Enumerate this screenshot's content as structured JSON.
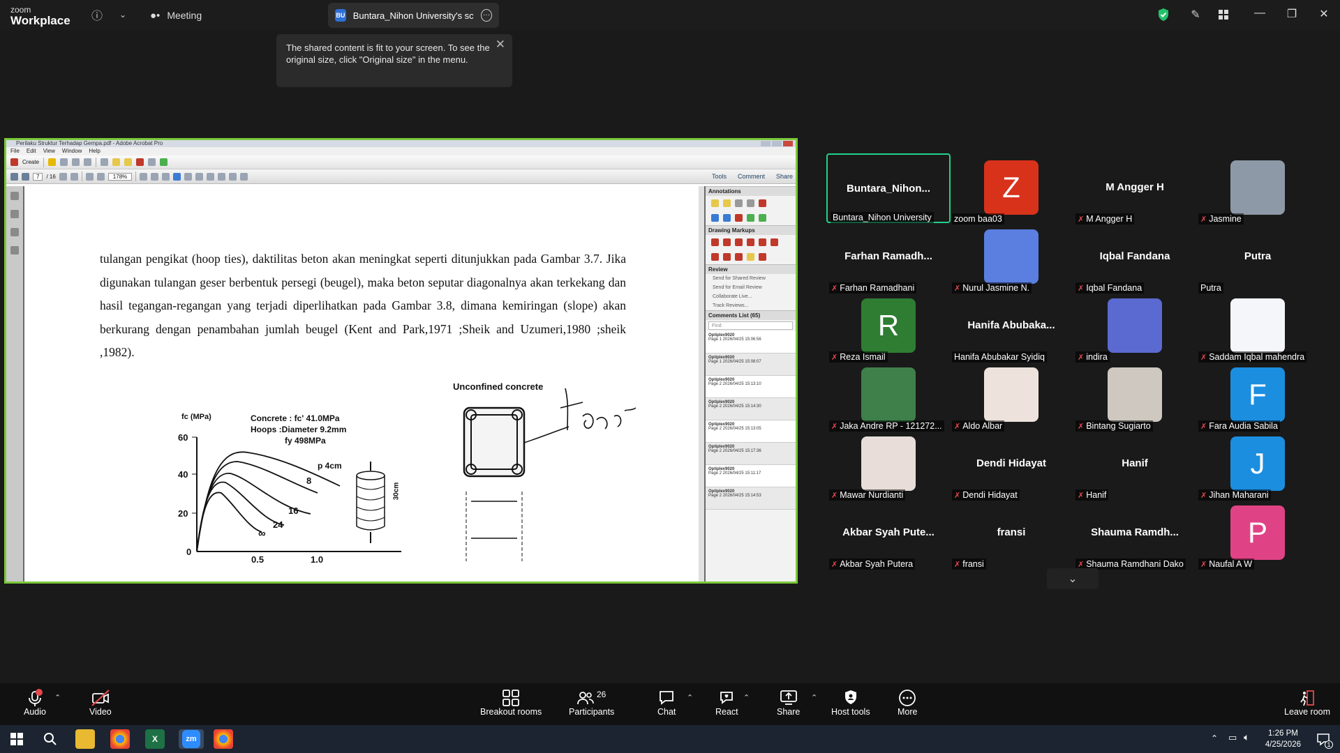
{
  "titlebar": {
    "logo_small": "zoom",
    "logo_big": "Workplace",
    "meeting_label": "Meeting",
    "share_initials": "BU",
    "share_tab_label": "Buntara_Nihon University's screen"
  },
  "toast": {
    "message": "The shared content is fit to your screen. To see the original size, click \"Original size\" in the menu."
  },
  "acrobat": {
    "window_title": "Perilaku Struktur Terhadap Gempa.pdf - Adobe Acrobat Pro",
    "menu": [
      "File",
      "Edit",
      "View",
      "Window",
      "Help"
    ],
    "create_label": "Create",
    "page_current": "7",
    "page_total": "/ 16",
    "zoom": "178%",
    "right_tabs": [
      "Tools",
      "Comment",
      "Share"
    ],
    "panel": {
      "annotations": "Annotations",
      "drawing_markups": "Drawing Markups",
      "review": "Review",
      "review_items": [
        "Send for Shared Review",
        "Send for Email Review",
        "Collaborate Live...",
        "Track Reviews..."
      ],
      "comments_list": "Comments List (65)",
      "find_placeholder": "Find",
      "comments": [
        {
          "author": "Optiplex9020",
          "meta": "Page 1  2026/04/25 15:06:56"
        },
        {
          "author": "Optiplex9020",
          "meta": "Page 1  2026/04/25 15:08:07"
        },
        {
          "author": "Optiplex9020",
          "meta": "Page 2  2026/04/25 15:13:10"
        },
        {
          "author": "Optiplex9020",
          "meta": "Page 2  2026/04/25 15:14:30"
        },
        {
          "author": "Optiplex9020",
          "meta": "Page 2  2026/04/25 15:13:05"
        },
        {
          "author": "Optiplex9020",
          "meta": "Page 2  2026/04/25 15:17:36"
        },
        {
          "author": "Optiplex9020",
          "meta": "Page 2  2026/04/25 15:11:17"
        },
        {
          "author": "Optiplex9020",
          "meta": "Page 2  2026/04/25 15:14:53"
        }
      ]
    },
    "document": {
      "paragraph": "tulangan pengikat (hoop ties), daktilitas beton akan meningkat seperti ditunjukkan pada Gambar 3.7.  Jika digunakan tulangan geser berbentuk persegi (beugel), maka beton seputar diagonalnya akan terkekang dan hasil tegangan-regangan yang terjadi diperlihatkan pada Gambar 3.8, dimana kemiringan (slope) akan berkurang dengan penambahan jumlah beugel (Kent and Park,1971 ;Sheik and Uzumeri,1980 ;sheik ,1982).",
      "figure": {
        "ylabel": "fc (MPa)",
        "concrete": "Concrete : fc' 41.0MPa",
        "hoops": "Hoops :Diameter 9.2mm",
        "fy": "fy 498MPa",
        "y_ticks": [
          "60",
          "40",
          "20",
          "0"
        ],
        "x_ticks": [
          "0.5",
          "1.0"
        ],
        "curve_labels": [
          "p 4cm",
          "8",
          "16",
          "24",
          "∞"
        ],
        "cylinder_label": "30cm",
        "unconfined": "Unconfined  concrete",
        "handwriting": "geser"
      }
    }
  },
  "participants": [
    {
      "display": "Buntara_Nihon...",
      "label": "Buntara_Nihon University",
      "muted": false,
      "type": "name",
      "active": true
    },
    {
      "display": "Z",
      "label": "zoom baa03",
      "muted": false,
      "type": "letter",
      "color": "#d8321b"
    },
    {
      "display": "M Angger H",
      "label": "M Angger H",
      "muted": true,
      "type": "name"
    },
    {
      "display": "",
      "label": "Jasmine",
      "muted": true,
      "type": "photo",
      "color": "#8e99a8"
    },
    {
      "display": "Farhan  Ramadh...",
      "label": "Farhan Ramadhani",
      "muted": true,
      "type": "name"
    },
    {
      "display": "",
      "label": "Nurul Jasmine N.",
      "muted": true,
      "type": "photo",
      "color": "#5b7fe0"
    },
    {
      "display": "Iqbal Fandana",
      "label": "Iqbal Fandana",
      "muted": true,
      "type": "name"
    },
    {
      "display": "Putra",
      "label": "Putra",
      "muted": false,
      "type": "name"
    },
    {
      "display": "R",
      "label": "Reza Ismail",
      "muted": true,
      "type": "letter",
      "color": "#2e7d32"
    },
    {
      "display": "Hanifa  Abubaka...",
      "label": "Hanifa Abubakar Syidiq",
      "muted": false,
      "type": "name"
    },
    {
      "display": "",
      "label": "indira",
      "muted": true,
      "type": "photo",
      "color": "#5b6ad0"
    },
    {
      "display": "",
      "label": "Saddam Iqbal mahendra",
      "muted": true,
      "type": "photo",
      "color": "#f4f6fa"
    },
    {
      "display": "",
      "label": "Jaka Andre RP - 121272...",
      "muted": true,
      "type": "photo",
      "color": "#3f7f4a"
    },
    {
      "display": "",
      "label": "Aldo Albar",
      "muted": true,
      "type": "photo",
      "color": "#eee3dc"
    },
    {
      "display": "",
      "label": "Bintang Sugiarto",
      "muted": true,
      "type": "photo",
      "color": "#cfc8c0"
    },
    {
      "display": "F",
      "label": "Fara Audia Sabila",
      "muted": true,
      "type": "letter",
      "color": "#1b8ee0"
    },
    {
      "display": "",
      "label": "Mawar Nurdianti",
      "muted": true,
      "type": "photo",
      "color": "#e8ddd8"
    },
    {
      "display": "Dendi Hidayat",
      "label": "Dendi Hidayat",
      "muted": true,
      "type": "name"
    },
    {
      "display": "Hanif",
      "label": "Hanif",
      "muted": true,
      "type": "name"
    },
    {
      "display": "J",
      "label": "Jihan Maharani",
      "muted": true,
      "type": "letter",
      "color": "#1b8ee0"
    },
    {
      "display": "Akbar  Syah  Pute...",
      "label": "Akbar Syah Putera",
      "muted": true,
      "type": "name"
    },
    {
      "display": "fransi",
      "label": "fransi",
      "muted": true,
      "type": "name"
    },
    {
      "display": "Shauma  Ramdh...",
      "label": "Shauma Ramdhani Dako",
      "muted": true,
      "type": "name"
    },
    {
      "display": "P",
      "label": "Naufal A W",
      "muted": true,
      "type": "letter",
      "color": "#e04385"
    }
  ],
  "bottombar": {
    "audio": "Audio",
    "video": "Video",
    "breakout": "Breakout rooms",
    "participants": "Participants",
    "participants_count": "26",
    "chat": "Chat",
    "react": "React",
    "share": "Share",
    "host_tools": "Host tools",
    "more": "More",
    "leave": "Leave room"
  },
  "taskbar": {
    "time": "1:26 PM",
    "date": "4/25/2026",
    "notifications": "1"
  }
}
